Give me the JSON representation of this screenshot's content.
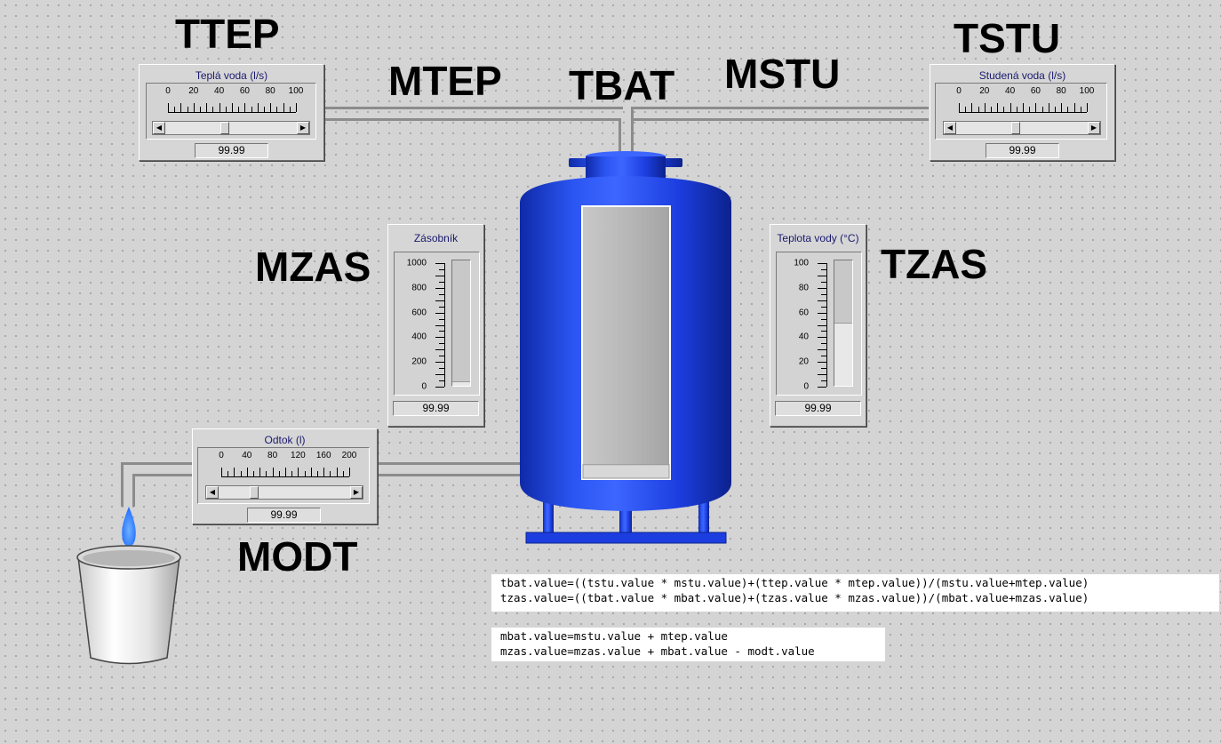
{
  "labels": {
    "ttep": "TTEP",
    "tstu": "TSTU",
    "mtep": "MTEP",
    "tbat": "TBAT",
    "mstu": "MSTU",
    "mzas": "MZAS",
    "tzas": "TZAS",
    "modt": "MODT"
  },
  "hot_water": {
    "title": "Teplá voda (l/s)",
    "scale": [
      "0",
      "20",
      "40",
      "60",
      "80",
      "100"
    ],
    "value": "99.99",
    "slider_fraction": 0.45
  },
  "cold_water": {
    "title": "Studená voda (l/s)",
    "scale": [
      "0",
      "20",
      "40",
      "60",
      "80",
      "100"
    ],
    "value": "99.99",
    "slider_fraction": 0.45
  },
  "outflow": {
    "title": "Odtok (l)",
    "scale": [
      "0",
      "40",
      "80",
      "120",
      "160",
      "200"
    ],
    "value": "99.99",
    "slider_fraction": 0.25
  },
  "reservoir": {
    "title": "Zásobník",
    "scale": [
      "1000",
      "800",
      "600",
      "400",
      "200",
      "0"
    ],
    "value": "99.99",
    "level_fraction": 0.03
  },
  "water_temp": {
    "title": "Teplota vody (°C)",
    "scale": [
      "100",
      "80",
      "60",
      "40",
      "20",
      "0"
    ],
    "value": "99.99",
    "level_fraction": 0.5
  },
  "tank": {
    "level_fraction": 0.05
  },
  "code": {
    "block1": [
      "tbat.value=((tstu.value * mstu.value)+(ttep.value * mtep.value))/(mstu.value+mtep.value)",
      "tzas.value=((tbat.value * mbat.value)+(tzas.value * mzas.value))/(mbat.value+mzas.value)"
    ],
    "block2": [
      "mbat.value=mstu.value + mtep.value",
      "mzas.value=mzas.value + mbat.value - modt.value"
    ]
  },
  "colors": {
    "tank_blue": "#1c3ee0",
    "panel_title": "#1a1a6e",
    "flame": "#1e6cff"
  }
}
